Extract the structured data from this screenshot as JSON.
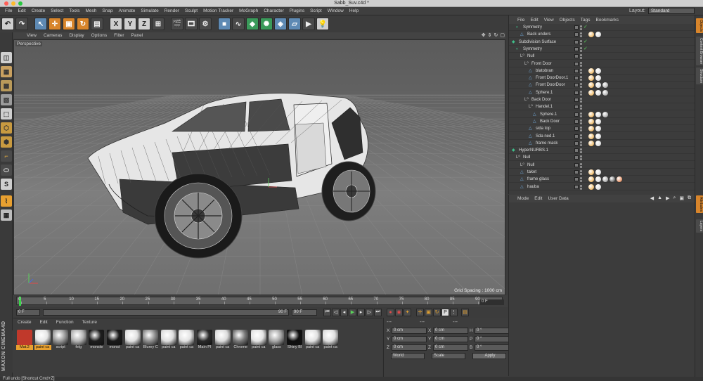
{
  "window": {
    "title": "Sabb_Suv.c4d *",
    "dots": [
      "#ff5f57",
      "#febc2e",
      "#28c840"
    ]
  },
  "menubar": [
    "File",
    "Edit",
    "Create",
    "Select",
    "Tools",
    "Mesh",
    "Snap",
    "Animate",
    "Simulate",
    "Render",
    "Sculpt",
    "Motion Tracker",
    "MoGraph",
    "Character",
    "Plugins",
    "Script",
    "Window",
    "Help"
  ],
  "layout": {
    "label": "Layout:",
    "value": "Standard"
  },
  "toolbar": {
    "x": "X",
    "y": "Y",
    "z": "Z"
  },
  "viewport": {
    "menu": [
      "View",
      "Cameras",
      "Display",
      "Options",
      "Filter",
      "Panel"
    ],
    "nav_icons": [
      "move-view-icon",
      "zoom-view-icon",
      "rotate-view-icon",
      "maximize-view-icon"
    ],
    "label": "Perspective",
    "grid_spacing": "Grid Spacing : 1000 cm"
  },
  "timeline": {
    "ticks": [
      "0",
      "5",
      "10",
      "15",
      "20",
      "25",
      "30",
      "35",
      "40",
      "45",
      "50",
      "55",
      "60",
      "65",
      "70",
      "75",
      "80",
      "85",
      "90"
    ],
    "frame_label": "0 F"
  },
  "transport": {
    "start": "0 F",
    "end_slider": "90 F",
    "end": "90 F"
  },
  "materials": {
    "menu": [
      "Create",
      "Edit",
      "Function",
      "Texture"
    ],
    "items": [
      {
        "label": "Mat.2",
        "color": "#c0392b",
        "selected": true
      },
      {
        "label": "paint ca",
        "color": "#e6e6e6",
        "selected": true
      },
      {
        "label": "script",
        "color": "#9a9a9a",
        "selected": false
      },
      {
        "label": "felg",
        "color": "#b5b5b5",
        "selected": false
      },
      {
        "label": "monste",
        "color": "#1e1e1e",
        "selected": false
      },
      {
        "label": "monst",
        "color": "#1a1a1a",
        "selected": false
      },
      {
        "label": "paint ca",
        "color": "#e0e0e0",
        "selected": false
      },
      {
        "label": "Blurey C",
        "color": "#8f8f8f",
        "selected": false
      },
      {
        "label": "paint ca",
        "color": "#dedede",
        "selected": false
      },
      {
        "label": "paint ca",
        "color": "#e2e2e2",
        "selected": false
      },
      {
        "label": "Main Pl",
        "color": "#2a2a2a",
        "selected": false
      },
      {
        "label": "paint ca",
        "color": "#dcdcdc",
        "selected": false
      },
      {
        "label": "Chrome",
        "color": "#7a7a7a",
        "selected": false
      },
      {
        "label": "paint ca",
        "color": "#e4e4e4",
        "selected": false
      },
      {
        "label": "glass",
        "color": "#a8a8a8",
        "selected": false
      },
      {
        "label": "Shiny Bl",
        "color": "#0f0f0f",
        "selected": false
      },
      {
        "label": "paint ca",
        "color": "#e1e1e1",
        "selected": false
      },
      {
        "label": "paint ca",
        "color": "#dfdfdf",
        "selected": false
      }
    ]
  },
  "coordinates": {
    "header": [
      "---",
      "---",
      "---"
    ],
    "rows": [
      {
        "a1": "X",
        "v1": "0 cm",
        "a2": "X",
        "v2": "0 cm",
        "a3": "H",
        "v3": "0 °"
      },
      {
        "a1": "Y",
        "v1": "0 cm",
        "a2": "Y",
        "v2": "0 cm",
        "a3": "P",
        "v3": "0 °"
      },
      {
        "a1": "Z",
        "v1": "0 cm",
        "a2": "Z",
        "v2": "0 cm",
        "a3": "B",
        "v3": "0 °"
      }
    ],
    "mode1": "World",
    "mode2": "Scale",
    "apply": "Apply"
  },
  "objects": {
    "menu": [
      "File",
      "Edit",
      "View",
      "Objects",
      "Tags",
      "Bookmarks"
    ],
    "rows": [
      {
        "name": "Symmetry",
        "indent": 1,
        "icon": "symmetry",
        "check": true,
        "tags": 0
      },
      {
        "name": "Back unders",
        "indent": 2,
        "icon": "poly",
        "check": false,
        "tags": 2
      },
      {
        "name": "Subdivision Surface",
        "indent": 0,
        "icon": "subdiv",
        "check": true,
        "tags": 0
      },
      {
        "name": "Symmetry",
        "indent": 1,
        "icon": "symmetry",
        "check": true,
        "tags": 0
      },
      {
        "name": "Null",
        "indent": 2,
        "icon": "null",
        "check": false,
        "tags": 0
      },
      {
        "name": "Front Door",
        "indent": 3,
        "icon": "null",
        "check": false,
        "tags": 0
      },
      {
        "name": "blatobran",
        "indent": 4,
        "icon": "poly",
        "check": false,
        "tags": 2
      },
      {
        "name": "Front DoorDoor.1",
        "indent": 4,
        "icon": "poly",
        "check": false,
        "tags": 2
      },
      {
        "name": "Front DoorDoor",
        "indent": 4,
        "icon": "poly",
        "check": false,
        "tags": 3
      },
      {
        "name": "Sphere.1",
        "indent": 4,
        "icon": "poly",
        "check": false,
        "tags": 3
      },
      {
        "name": "Back Door",
        "indent": 3,
        "icon": "null",
        "check": false,
        "tags": 0
      },
      {
        "name": "Handel.1",
        "indent": 4,
        "icon": "null",
        "check": false,
        "tags": 0
      },
      {
        "name": "Sphere.1",
        "indent": 5,
        "icon": "poly",
        "check": false,
        "tags": 3
      },
      {
        "name": "Back Door",
        "indent": 5,
        "icon": "poly",
        "check": false,
        "tags": 2
      },
      {
        "name": "sida top",
        "indent": 4,
        "icon": "poly",
        "check": false,
        "tags": 2
      },
      {
        "name": "Sda ned.1",
        "indent": 4,
        "icon": "poly",
        "check": false,
        "tags": 2
      },
      {
        "name": "frame mask",
        "indent": 4,
        "icon": "poly",
        "check": false,
        "tags": 2
      },
      {
        "name": "HyperNURBS.1",
        "indent": 0,
        "icon": "subdiv",
        "check": false,
        "tags": 0
      },
      {
        "name": "Null",
        "indent": 1,
        "icon": "null",
        "check": false,
        "tags": 0
      },
      {
        "name": "Null",
        "indent": 2,
        "icon": "null",
        "check": false,
        "tags": 0
      },
      {
        "name": "taket",
        "indent": 2,
        "icon": "poly",
        "check": false,
        "tags": 2
      },
      {
        "name": "frame glass",
        "indent": 2,
        "icon": "poly",
        "check": false,
        "tags": 5
      },
      {
        "name": "hauba",
        "indent": 2,
        "icon": "poly",
        "check": false,
        "tags": 2
      }
    ]
  },
  "attributes": {
    "menu": [
      "Mode",
      "Edit",
      "User Data"
    ]
  },
  "sidetabs": [
    {
      "label": "Objects",
      "active": true
    },
    {
      "label": "Content Browser",
      "active": false
    },
    {
      "label": "Structure",
      "active": false
    },
    {
      "label": "Attributes",
      "active": true
    },
    {
      "label": "Layers",
      "active": false
    }
  ],
  "status": "Full undo [Shortcut Cmd+Z]",
  "brand": "MAXON CINEMA4D"
}
